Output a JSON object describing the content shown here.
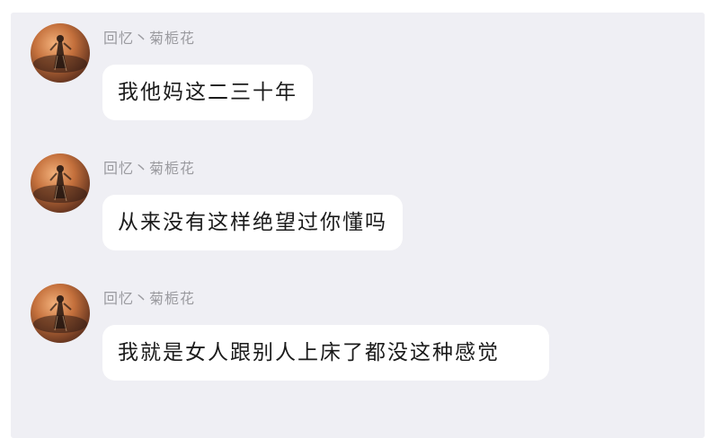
{
  "messages": [
    {
      "sender": "回忆丶菊栀花",
      "text": "我他妈这二三十年"
    },
    {
      "sender": "回忆丶菊栀花",
      "text": "从来没有这样绝望过你懂吗"
    },
    {
      "sender": "回忆丶菊栀花",
      "text": "我就是女人跟别人上床了都没这种感觉"
    }
  ],
  "colors": {
    "panel_bg": "#efeff4",
    "bubble_bg": "#ffffff",
    "sender_text": "#9a9a9f",
    "message_text": "#1b1b1b"
  },
  "icons": {
    "avatar": "avatar-photo-icon"
  }
}
